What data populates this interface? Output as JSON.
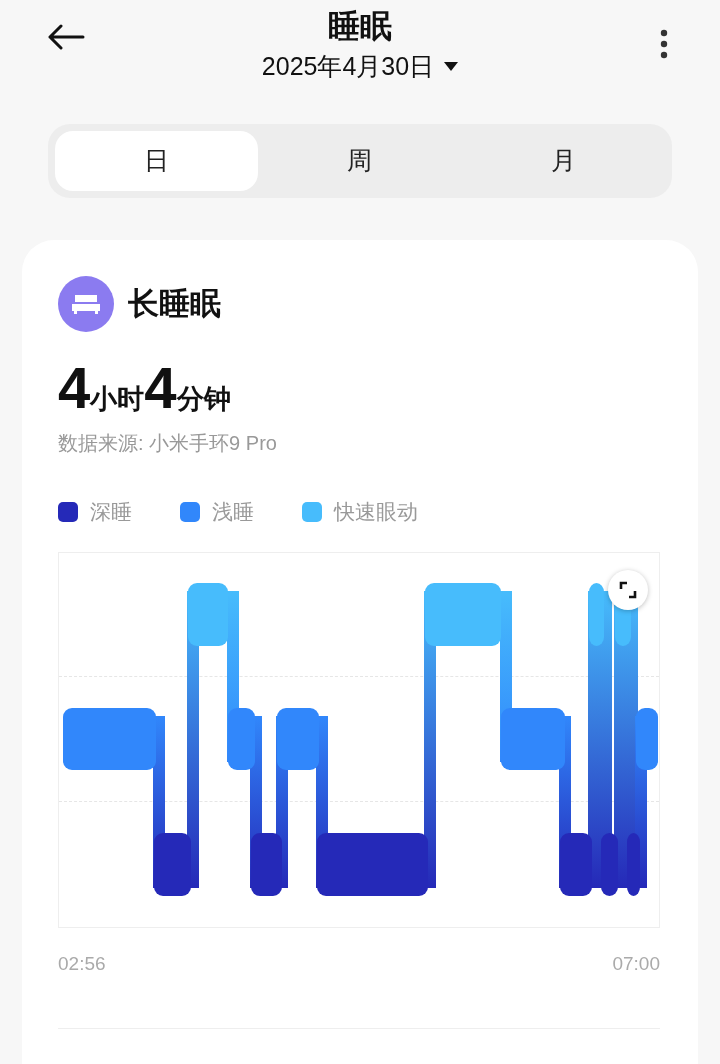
{
  "header": {
    "title": "睡眠",
    "date": "2025年4月30日"
  },
  "tabs": [
    {
      "label": "日",
      "selected": true
    },
    {
      "label": "周",
      "selected": false
    },
    {
      "label": "月",
      "selected": false
    }
  ],
  "card": {
    "title": "长睡眠",
    "duration": [
      {
        "kind": "number",
        "text": "4"
      },
      {
        "kind": "unit",
        "text": "小时"
      },
      {
        "kind": "number",
        "text": "4"
      },
      {
        "kind": "unit",
        "text": "分钟"
      }
    ],
    "source": "数据来源: 小米手环9 Pro",
    "legend": [
      {
        "label": "深睡",
        "color": "#2529b8"
      },
      {
        "label": "浅睡",
        "color": "#3187fb"
      },
      {
        "label": "快速眼动",
        "color": "#47bcfc"
      }
    ],
    "time_start": "02:56",
    "time_end": "07:00"
  }
}
